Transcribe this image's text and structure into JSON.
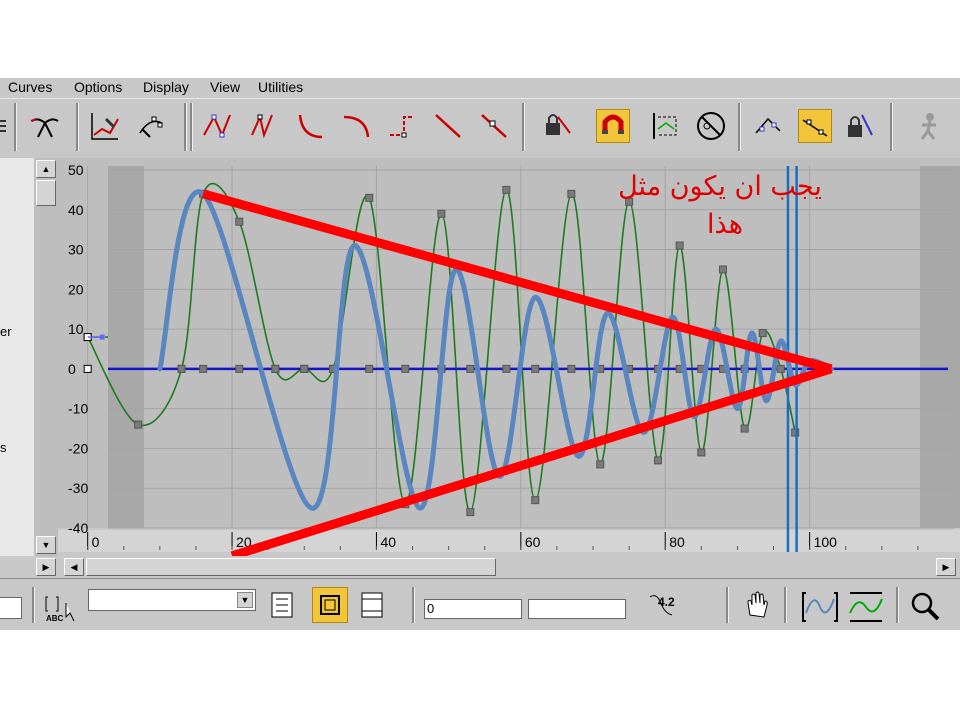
{
  "menu": {
    "items": [
      "Curves",
      "Options",
      "Display",
      "View",
      "Utilities"
    ]
  },
  "toolbar": {
    "buttons": [
      "set-key-icon",
      "navigate-icon",
      "add-keys-icon",
      "move-keys-icon",
      "smooth-tangent-icon",
      "auto-tangent-icon",
      "fast-tangent-icon",
      "slow-tangent-icon",
      "step-tangent-icon",
      "linear-tangent-icon",
      "custom-tangent-icon",
      "lock-selection-icon",
      "snap-frames-icon",
      "parameter-curve-icon",
      "show-keyable-icon",
      "show-tangents-icon",
      "lock-tangents-icon",
      "lock-handles-icon",
      "figure-icon"
    ],
    "active": [
      "snap-frames-icon",
      "lock-tangents-icon"
    ]
  },
  "left_panel": {
    "fragments": [
      "er",
      "s"
    ]
  },
  "annotation": {
    "line1": "يجب ان يكون مثل",
    "line2": "هذا"
  },
  "statusbar": {
    "frame_value": "0",
    "time_value": "",
    "value_readout": "4.2",
    "dropdown_value": ""
  },
  "colors": {
    "panel": "#c8c8c8",
    "graph_bg": "#bebebe",
    "green_curve": "#1e7a1e",
    "blue_line": "#1414c8",
    "blue_curve": "#5a86c0",
    "red": "#ff0000",
    "time_slider": "#1a6ec0",
    "annotation_text": "#e00000"
  },
  "chart_data": {
    "type": "line",
    "title": "",
    "xlabel": "",
    "ylabel": "",
    "x_ticks": [
      "0",
      "20",
      "40",
      "60",
      "80",
      "100"
    ],
    "y_ticks": [
      "50",
      "40",
      "30",
      "20",
      "10",
      "0",
      "-10",
      "-20",
      "-30",
      "-40"
    ],
    "xlim": [
      -3,
      120
    ],
    "ylim": [
      -40,
      51
    ],
    "grid": true,
    "time_slider_x": [
      97,
      98.2
    ],
    "series": [
      {
        "curve": "green",
        "keys_x": [
          0,
          7,
          13,
          16,
          21,
          26,
          30,
          34,
          39,
          44,
          49,
          53,
          58,
          62,
          67,
          71,
          75,
          79,
          82,
          85,
          88,
          91,
          93.5,
          96,
          98
        ],
        "keys_y": [
          8,
          -14,
          0,
          44,
          37,
          0,
          0,
          0,
          43,
          -34,
          39,
          -36,
          45,
          -33,
          44,
          -24,
          42,
          -23,
          31,
          -21,
          25,
          -15,
          9,
          0,
          -16
        ]
      },
      {
        "curve": "blue-flat",
        "keys_x": [
          0,
          13,
          16,
          21,
          26,
          30,
          34,
          39,
          44,
          49,
          53,
          58,
          62,
          67,
          71,
          75,
          79,
          82,
          85,
          88,
          91
        ],
        "keys_y": [
          0,
          0,
          0,
          0,
          0,
          0,
          0,
          0,
          0,
          0,
          0,
          0,
          0,
          0,
          0,
          0,
          0,
          0,
          0,
          0,
          0
        ]
      },
      {
        "curve": "blue-drawn",
        "points_x": [
          10,
          16,
          31,
          37,
          46,
          51,
          57,
          62,
          68,
          72,
          77,
          81,
          84,
          87,
          90,
          92,
          94,
          96,
          98,
          100,
          103
        ],
        "points_y": [
          0,
          44,
          -35,
          31,
          -35,
          25,
          -27,
          18,
          -22,
          14,
          -16,
          13,
          -12,
          10,
          -10,
          9,
          -8,
          7,
          -4,
          2,
          0
        ]
      }
    ],
    "envelope": [
      {
        "from": [
          16,
          44
        ],
        "to": [
          103,
          0
        ]
      },
      {
        "from": [
          20,
          -47
        ],
        "to": [
          103,
          0
        ]
      }
    ]
  }
}
